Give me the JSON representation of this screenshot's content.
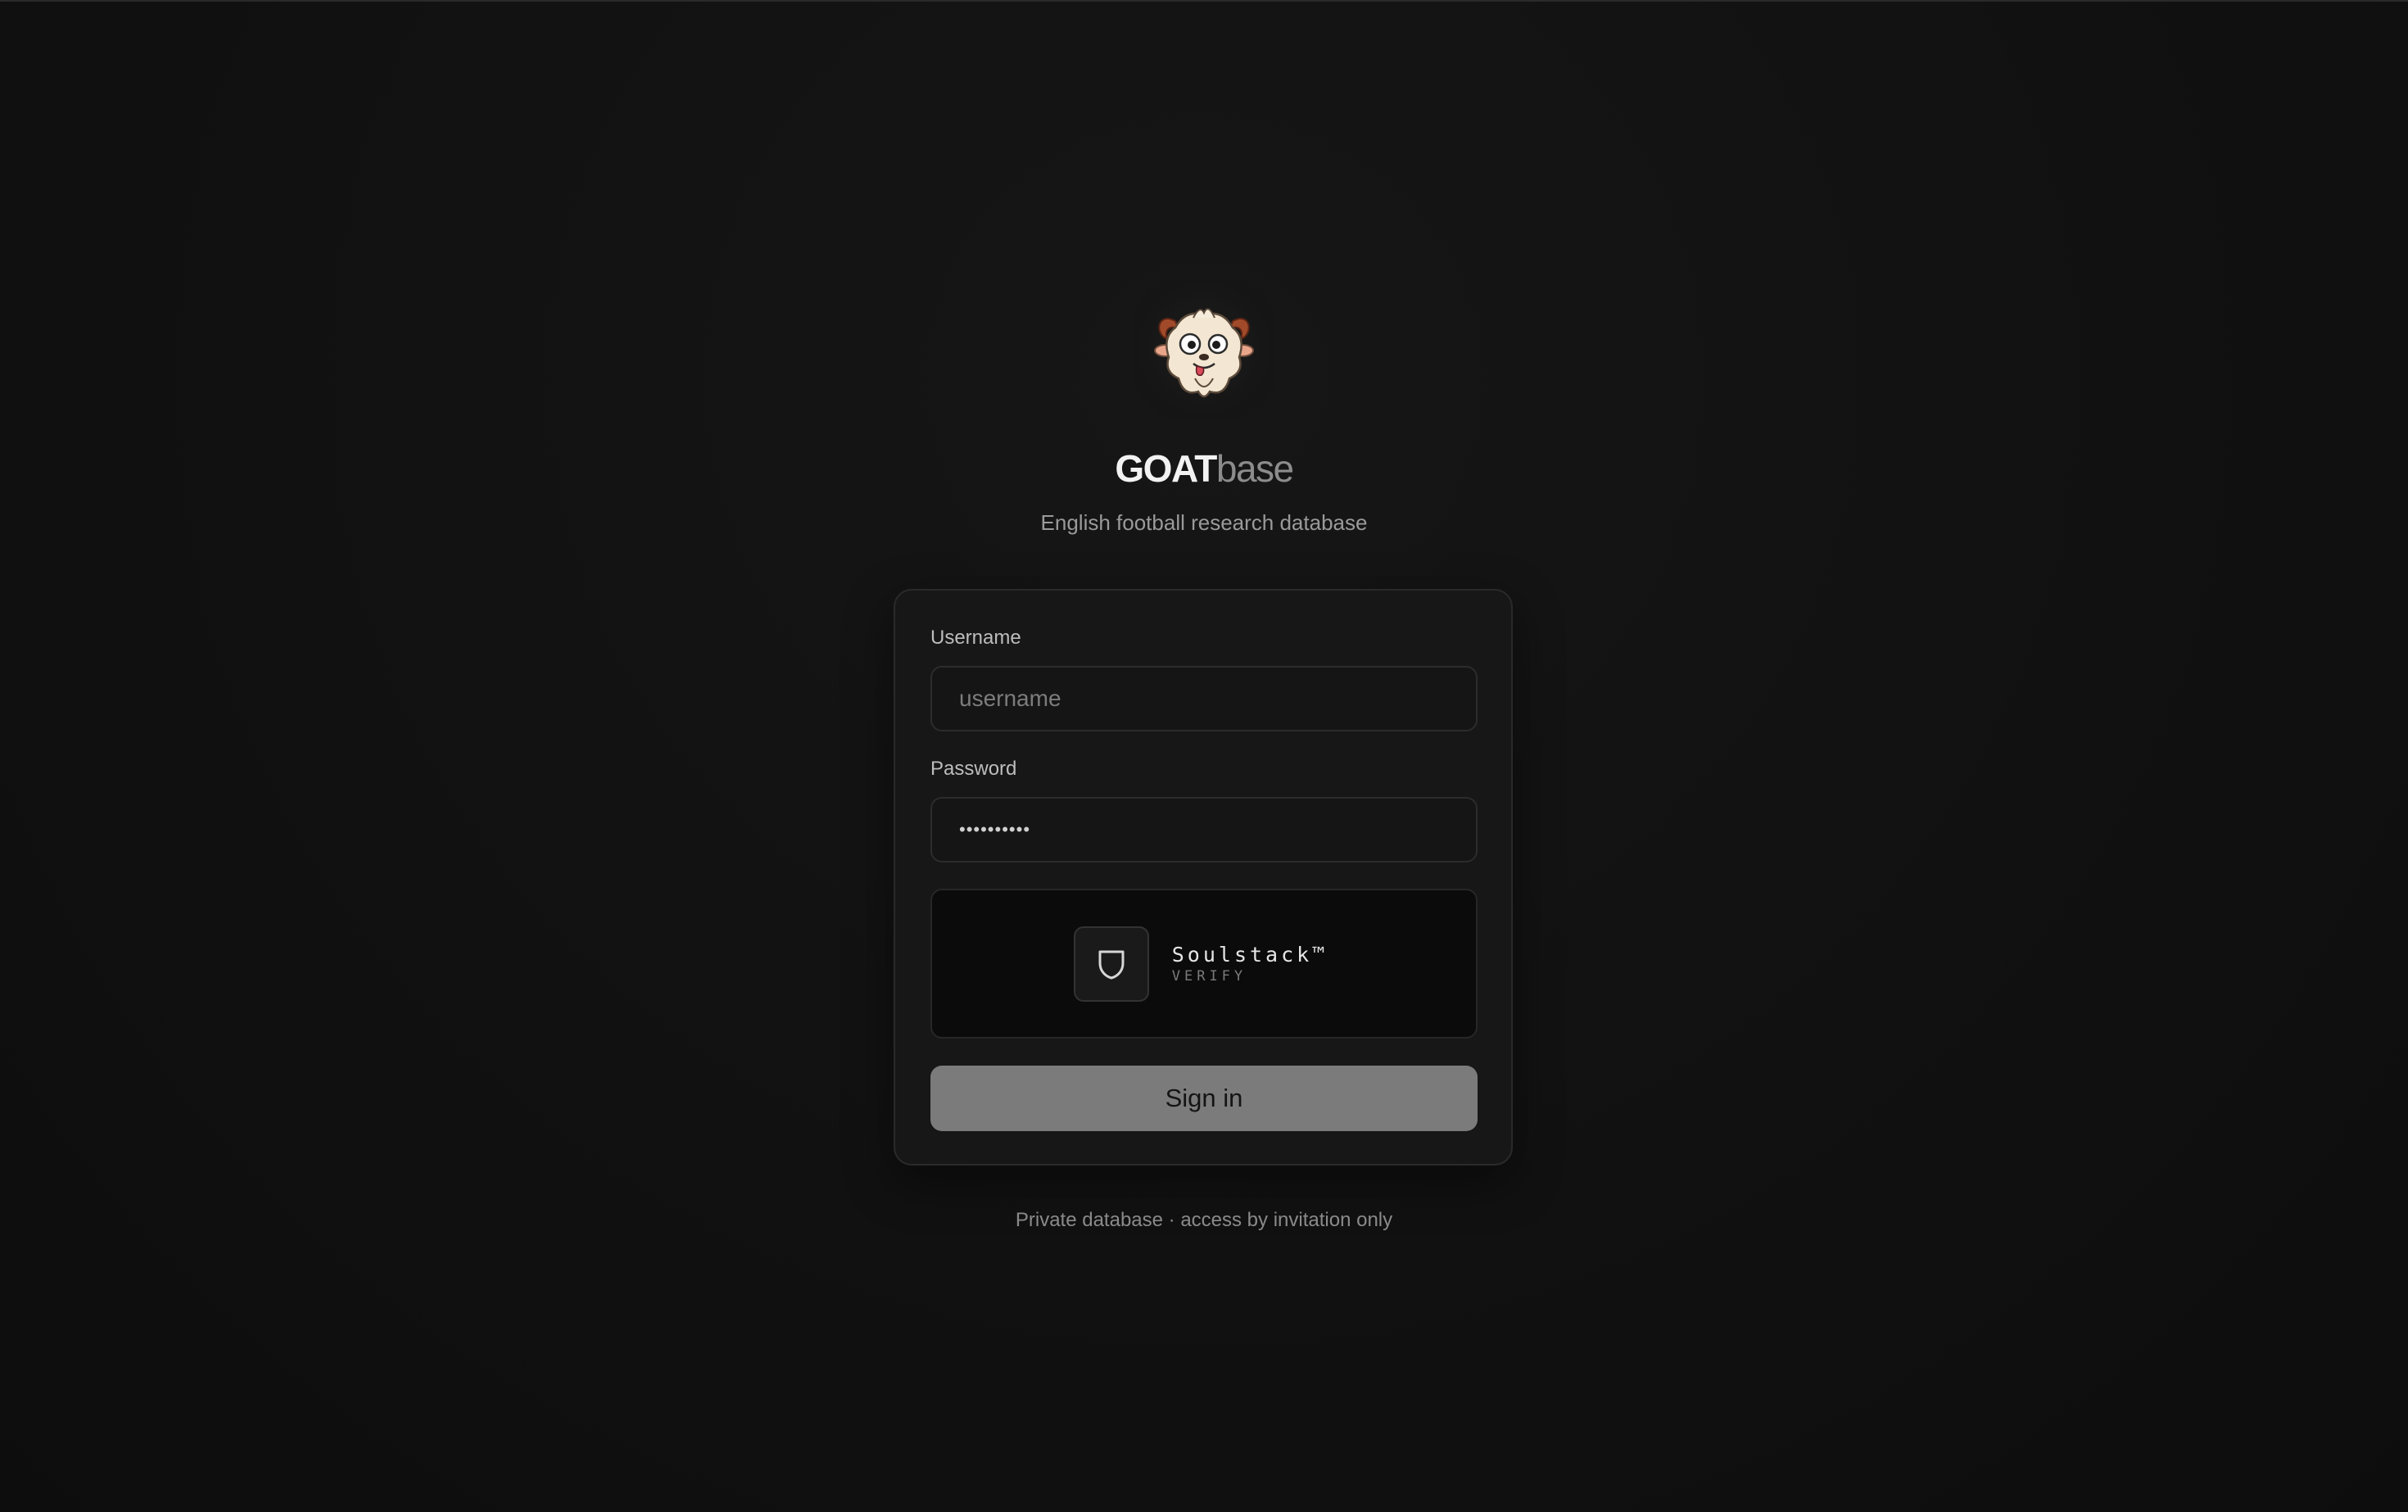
{
  "brand": {
    "logo_icon": "goat-mascot-icon",
    "title_strong": "GOAT",
    "title_soft": "base",
    "subtitle": "English football research database"
  },
  "form": {
    "username_label": "Username",
    "username_placeholder": "username",
    "username_value": "",
    "password_label": "Password",
    "password_value": "••••••••••",
    "verify": {
      "icon": "shield-icon",
      "brand": "Soulstack™",
      "sub": "VERIFY"
    },
    "submit_label": "Sign in"
  },
  "footer": {
    "text": "Private database · access by invitation only"
  },
  "colors": {
    "background": "#121212",
    "card": "#171717",
    "button": "#7b7b7b",
    "muted_text": "#8c8c8c"
  }
}
